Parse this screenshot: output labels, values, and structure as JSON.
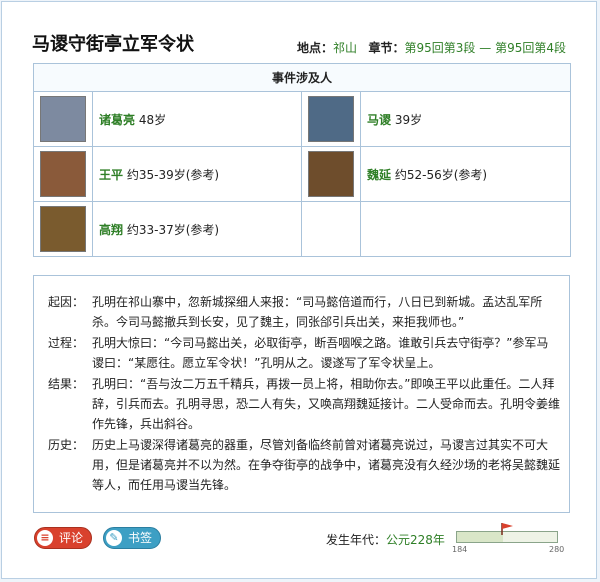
{
  "header": {
    "title": "马谡守街亭立军令状",
    "location_label": "地点：",
    "location": "祁山",
    "chapter_label": "章节：",
    "chapter_start": "第95回第3段",
    "chapter_sep": "—",
    "chapter_end": "第95回第4段"
  },
  "people": {
    "heading": "事件涉及人",
    "rows": [
      [
        {
          "name": "诸葛亮",
          "age": "48岁",
          "portrait_color": "#7d8aa0"
        },
        {
          "name": "马谡",
          "age": "39岁",
          "portrait_color": "#4f6a86"
        }
      ],
      [
        {
          "name": "王平",
          "age": "约35-39岁(参考)",
          "portrait_color": "#8a5a3a"
        },
        {
          "name": "魏延",
          "age": "约52-56岁(参考)",
          "portrait_color": "#6e4d2c"
        }
      ],
      [
        {
          "name": "高翔",
          "age": "约33-37岁(参考)",
          "portrait_color": "#7a5b2e"
        }
      ]
    ]
  },
  "story": [
    {
      "label": "起因：",
      "text": "孔明在祁山寨中，忽新城探细人来报：“司马懿倍道而行，八日已到新城。孟达乱军所杀。今司马懿撤兵到长安，见了魏主，同张郃引兵出关，来拒我师也。”"
    },
    {
      "label": "过程：",
      "text": "孔明大惊曰：“今司马懿出关，必取街亭，断吾咽喉之路。谁敢引兵去守街亭？”参军马谡曰：“某愿往。愿立军令状！”孔明从之。谡遂写了军令状呈上。"
    },
    {
      "label": "结果：",
      "text": "孔明曰：“吾与汝二万五千精兵，再拨一员上将，相助你去。”即唤王平以此重任。二人拜辞，引兵而去。孔明寻思，恐二人有失，又唤高翔魏延接计。二人受命而去。孔明令姜维作先锋，兵出斜谷。"
    },
    {
      "label": "历史：",
      "text": "历史上马谡深得诸葛亮的器重，尽管刘备临终前曾对诸葛亮说过，马谡言过其实不可大用，但是诸葛亮并不以为然。在争夺街亭的战争中，诸葛亮没有久经沙场的老将吴懿魏延等人，而任用马谡当先锋。"
    }
  ],
  "footer": {
    "comment_label": "评论",
    "bookmark_label": "书签",
    "era_label": "发生年代：",
    "era_value": "公元228年",
    "timeline_start": "184",
    "timeline_end": "280",
    "timeline_year": 228,
    "flag_color": "#d9412d"
  }
}
